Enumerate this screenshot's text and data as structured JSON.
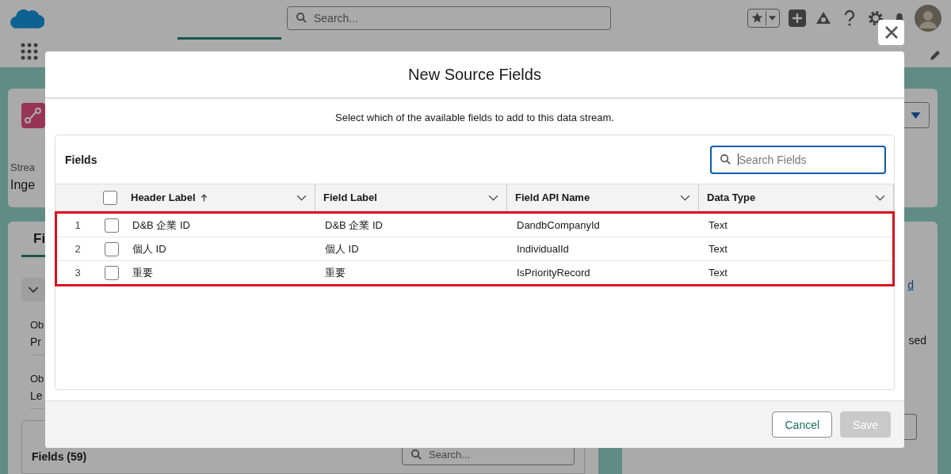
{
  "app_header": {
    "search_placeholder": "Search..."
  },
  "background": {
    "stream_card": {
      "label": "Strea",
      "value": "Inge"
    },
    "detail_panel": {
      "tab": "Fi",
      "fields": [
        {
          "label": "Ob",
          "value": "Pr"
        },
        {
          "label": "Ob",
          "value": "Le"
        }
      ],
      "fields_card": {
        "title": "Fields (59)",
        "search_placeholder": "Search..."
      }
    },
    "side_panel": {
      "link": "d",
      "text": "sed"
    }
  },
  "modal": {
    "title": "New Source Fields",
    "instruction": "Select which of the available fields to add to this data stream.",
    "card_title": "Fields",
    "search_placeholder": "Search Fields",
    "select_all": {
      "checked": false
    },
    "columns": [
      {
        "label": "Header Label",
        "sorted": true
      },
      {
        "label": "Field Label",
        "sorted": false
      },
      {
        "label": "Field API Name",
        "sorted": false
      },
      {
        "label": "Data Type",
        "sorted": false
      }
    ],
    "highlighted": true,
    "rows": [
      {
        "number": "1",
        "checked": false,
        "cells": [
          "D&B 企業 ID",
          "D&B 企業 ID",
          "DandbCompanyId",
          "Text"
        ]
      },
      {
        "number": "2",
        "checked": false,
        "cells": [
          "個人 ID",
          "個人 ID",
          "IndividualId",
          "Text"
        ]
      },
      {
        "number": "3",
        "checked": false,
        "cells": [
          "重要",
          "重要",
          "IsPriorityRecord",
          "Text"
        ]
      }
    ],
    "buttons": [
      {
        "label": "Cancel",
        "disabled": false
      },
      {
        "label": "Save",
        "disabled": true
      }
    ]
  }
}
